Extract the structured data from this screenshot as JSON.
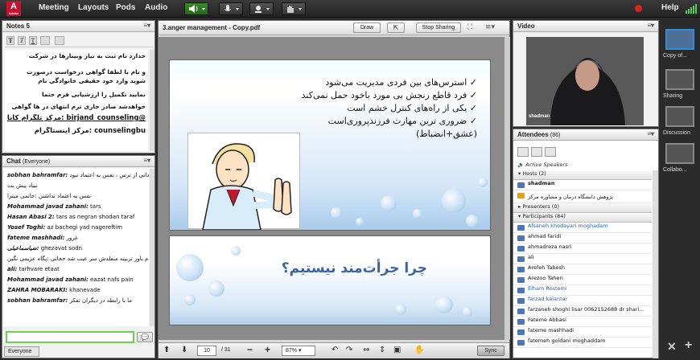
{
  "topbar": {
    "logo": "Adobe",
    "menus": [
      "Meeting",
      "Layouts",
      "Pods",
      "Audio"
    ],
    "help": "Help"
  },
  "notes": {
    "title": "Notes 5",
    "lines": [
      "حدارد نام ثبت به نیاز وبینارها در شرکت",
      "و نام با لطفا گواهی درخواست درصورت",
      "شوید وارد خود حقیقی خانوادگی نام",
      "نمایید تکمیل را ارزشیابی فرم حتما",
      "خواهدشد صادر جاری ترم انتهای در ها گواهی",
      "@birjand_counseling :مرکز تلگرام کانال",
      "counselingbu :مرکز اینستاگرام"
    ]
  },
  "chat": {
    "title": "Chat",
    "scope": "(Everyone)",
    "messages": [
      {
        "name": "sobhan bahramfar:",
        "text": "جیغ که شیادانی از ترس ، نفس به اعتماد نبود"
      },
      {
        "name": "",
        "text": "نبیاد پیش بت"
      },
      {
        "name": "",
        "text": "نفس به اعتماد نداشتن :خانمی میترا"
      },
      {
        "name": "Mohammad javad zahani:",
        "text": "tars"
      },
      {
        "name": "Hasan Abasi 2:",
        "text": "tars as negran shodan taraf"
      },
      {
        "name": "Yosef Toghi:",
        "text": "az bachegi yad nagereftim"
      },
      {
        "name": "fateme mashhadi:",
        "text": "غرور"
      },
      {
        "name": "ضیاسماعیلی:",
        "text": "ghezavat sodn"
      },
      {
        "name": "",
        "text": "عدم باور تربیته منفلدش سر عیب شد حجاتی :پگاه عزیمی نگین"
      },
      {
        "name": "ali:",
        "text": "tarhvare etaat"
      },
      {
        "name": "Mohammad javad zahani:",
        "text": "eazat nafs pain"
      },
      {
        "name": "ZAHRA MOBARAKI:",
        "text": "khanevade"
      },
      {
        "name": "sobhan bahramfar:",
        "text": "ما با رابطه در دیگران تفکر"
      }
    ],
    "input_placeholder": "",
    "recipient": "Everyone"
  },
  "share": {
    "title": "3.anger management - Copy.pdf",
    "draw": "Draw",
    "stop": "Stop Sharing",
    "slide1": [
      "استرس‌های بین فردی مدیریت می‌شود",
      "فرد قاطع رنجش بی مورد باخود حمل نمی‌کند",
      "یکی از راه‌های کنترل خشم است",
      "ضروری ترین مهارت فرزندپرورى‌است (عشق+انضباط)"
    ],
    "slide2": "چرا جرأت‌مند نیستیم؟",
    "page": "10",
    "pages": "/ 31",
    "zoom": "87%",
    "sync": "Sync"
  },
  "video": {
    "title": "Video",
    "name": "shadman",
    "count": "(1)"
  },
  "attendees": {
    "title": "Attendees",
    "count": "(86)",
    "active": "Active Speakers",
    "hosts_label": "Hosts (2)",
    "hosts": [
      "shadman",
      "پژوهش دانشگاه درمان و مشاوره مرکز"
    ],
    "presenters_label": "Presenters (0)",
    "participants_label": "Participants (84)",
    "participants": [
      {
        "name": "Afsaneh khodayari moghadam",
        "blue": true
      },
      {
        "name": "ahmad faridi",
        "blue": false
      },
      {
        "name": "ahmadreza nasri",
        "blue": false
      },
      {
        "name": "ali",
        "blue": false
      },
      {
        "name": "Arefeh Tabesh",
        "blue": false
      },
      {
        "name": "Arezoo Taheri",
        "blue": false
      },
      {
        "name": "Elham Rostemi",
        "blue": true
      },
      {
        "name": "farzad kalantar",
        "blue": true
      },
      {
        "name": "farzaneh shoghi lisar 0062152688 dr shari...",
        "blue": false
      },
      {
        "name": "Fateme Abbasi",
        "blue": false
      },
      {
        "name": "fateme mashhadi",
        "blue": false
      },
      {
        "name": "fatemeh goldani moghaddam",
        "blue": false
      }
    ]
  },
  "right": {
    "items": [
      "Copy of...",
      "Sharing",
      "Discussion",
      "Collabo..."
    ]
  },
  "colors": {
    "accent": "#2f8fd6",
    "rec": "#e02020"
  }
}
